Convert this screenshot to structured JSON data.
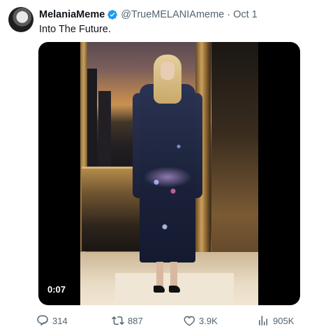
{
  "post": {
    "author_name": "MelaniaMeme",
    "handle": "@TrueMELANIAmeme",
    "separator": "·",
    "date": "Oct 1",
    "text": "Into The Future.",
    "verified_icon": "verified-badge-icon"
  },
  "media": {
    "duration": "0:07"
  },
  "actions": {
    "replies": "314",
    "retweets": "887",
    "likes": "3.9K",
    "views": "905K"
  },
  "colors": {
    "text": "#0f1419",
    "muted": "#536471",
    "verified": "#1d9bf0"
  }
}
